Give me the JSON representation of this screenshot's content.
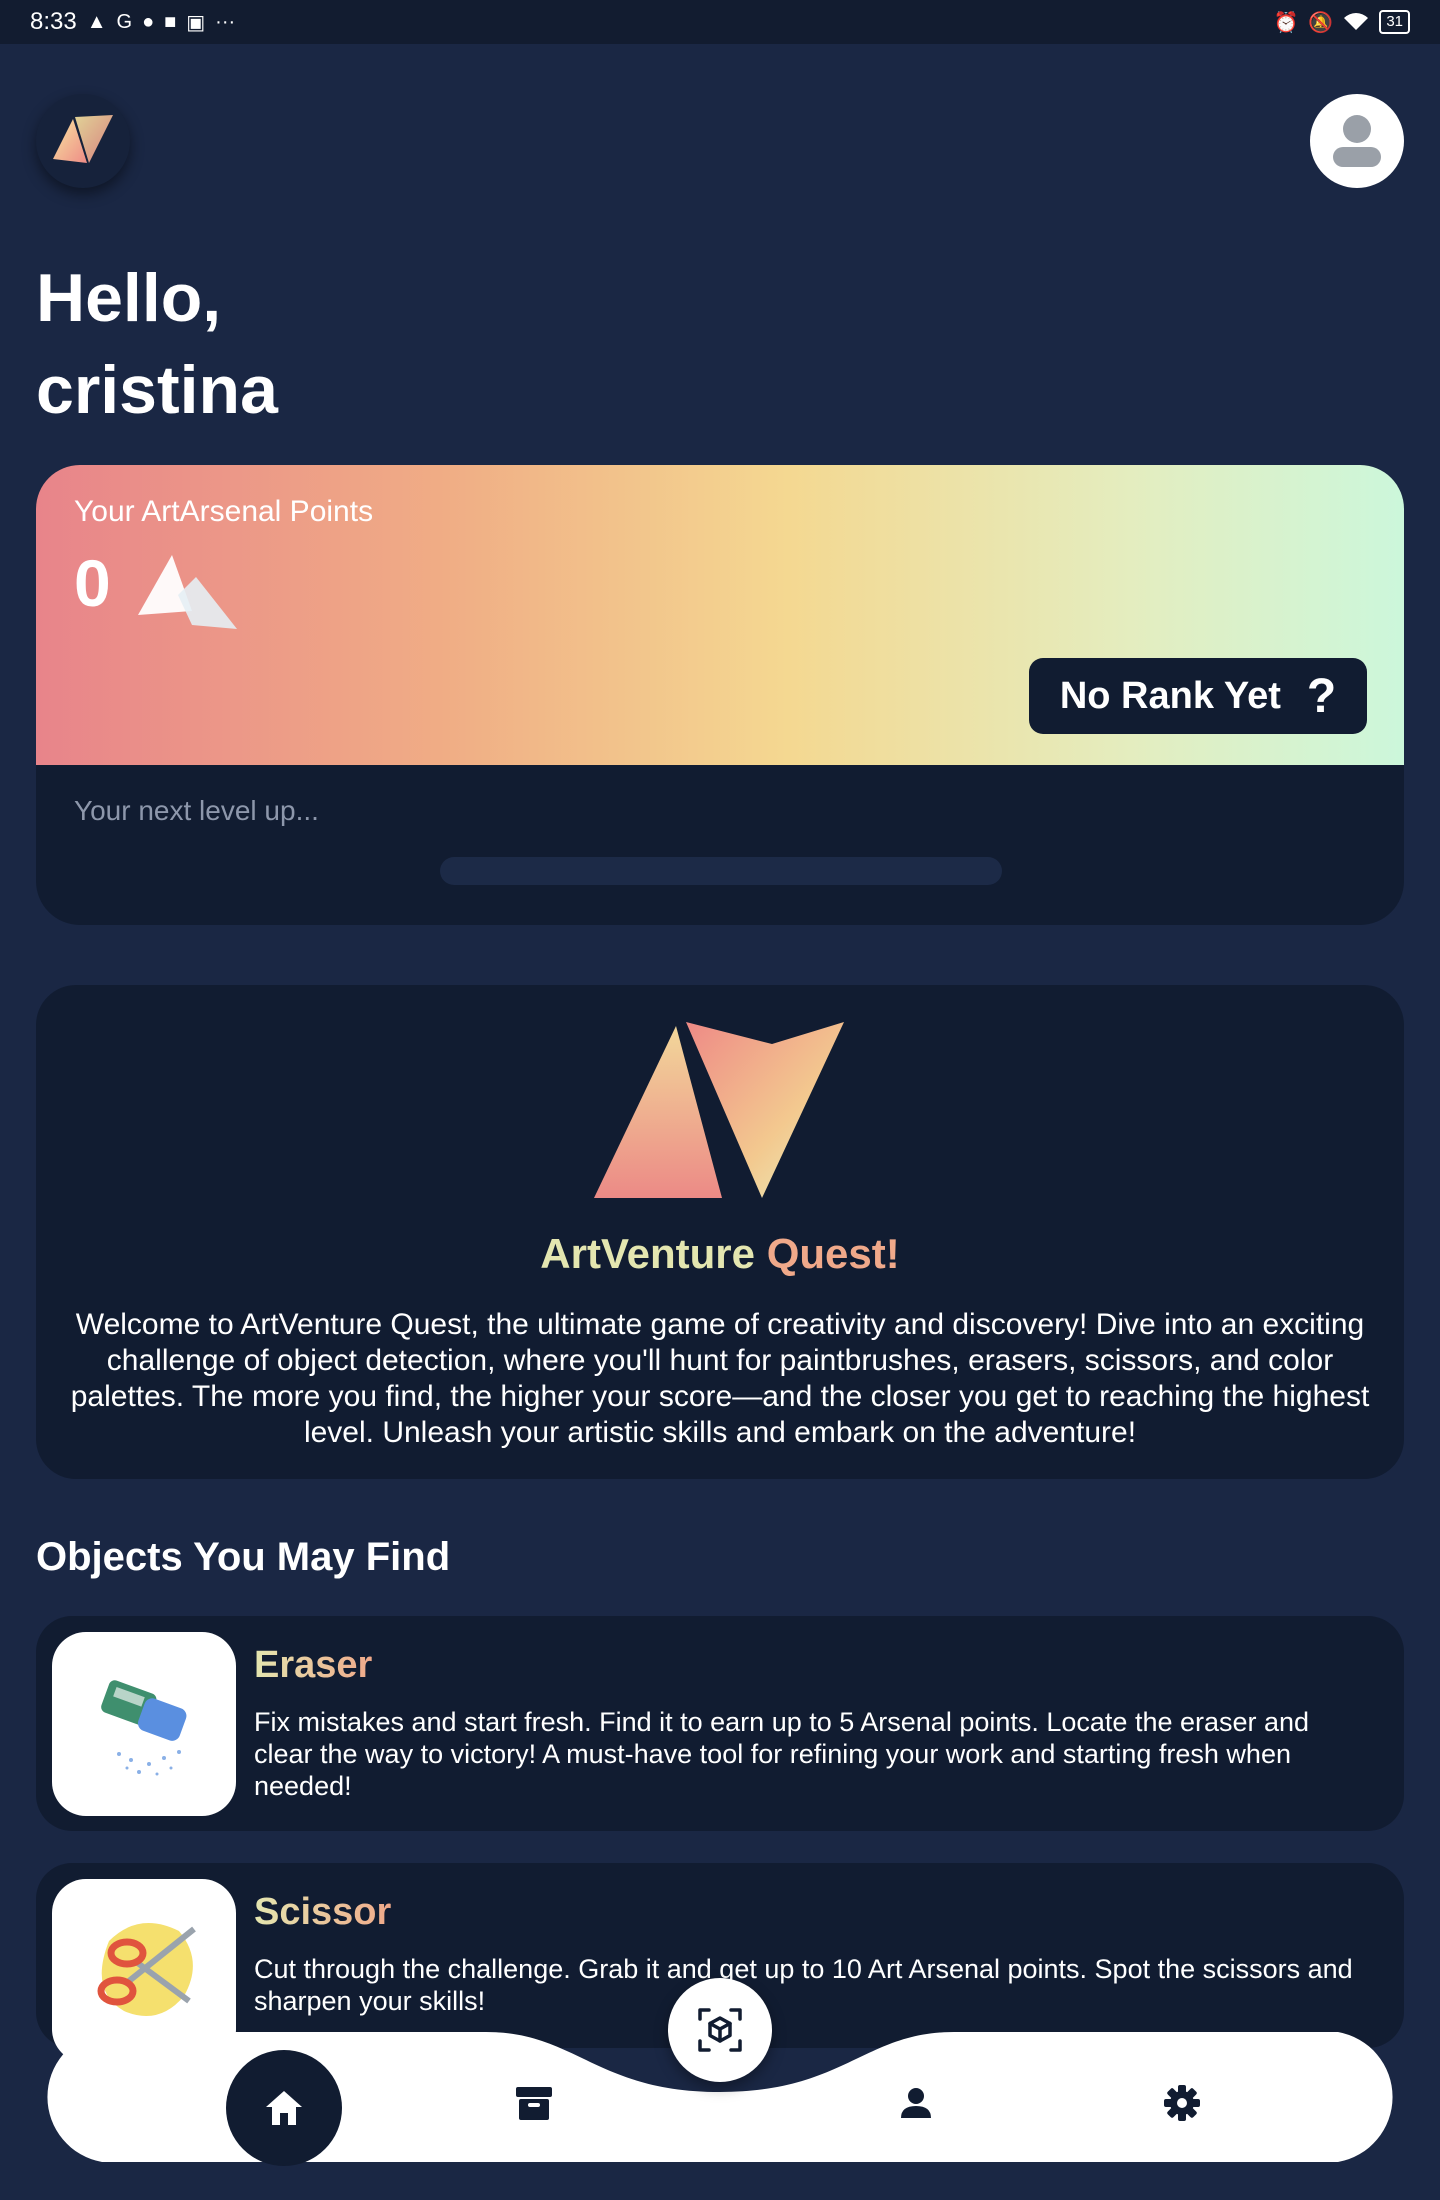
{
  "status_bar": {
    "time": "8:33",
    "left_icons": [
      "a-icon",
      "google-icon",
      "c-icon",
      "bag-icon",
      "app-icon",
      "more-icon"
    ],
    "right_icons": [
      "alarm-icon",
      "mute-icon",
      "wifi-icon"
    ],
    "battery": "31"
  },
  "header": {
    "greeting_line1": "Hello,",
    "greeting_line2": "cristina"
  },
  "points_card": {
    "label": "Your ArtArsenal Points",
    "value": "0",
    "rank": "No Rank Yet",
    "rank_help": "?",
    "next_level": "Your next level up...",
    "progress": 0
  },
  "quest": {
    "title_part1": "ArtVenture",
    "title_part2": "Quest!",
    "description": "Welcome to ArtVenture Quest, the ultimate game of creativity and discovery! Dive into an exciting challenge of object detection, where you'll hunt for paintbrushes, erasers, scissors, and color palettes. The more you find, the higher your score—and the closer you get to reaching the highest level. Unleash your artistic skills and embark on the adventure!"
  },
  "objects": {
    "section_title": "Objects You May Find",
    "items": [
      {
        "name": "Eraser",
        "description": "Fix mistakes and start fresh. Find it to earn up to 5 Arsenal points. Locate the eraser and clear the way to victory! A must-have tool for refining your work and starting fresh when needed!"
      },
      {
        "name": "Scissor",
        "description": "Cut through the challenge. Grab it and get up to 10 Art Arsenal points. Spot the scissors and sharpen your skills!"
      }
    ]
  },
  "nav": {
    "items": [
      "home-icon",
      "archive-icon",
      "scan-icon",
      "person-icon",
      "settings-icon"
    ],
    "active": "home"
  },
  "colors": {
    "background": "#1a2744",
    "card": "#111c31",
    "gradient_start": "#e8848a",
    "gradient_mid": "#f4d891",
    "gradient_end": "#ccf7db"
  }
}
